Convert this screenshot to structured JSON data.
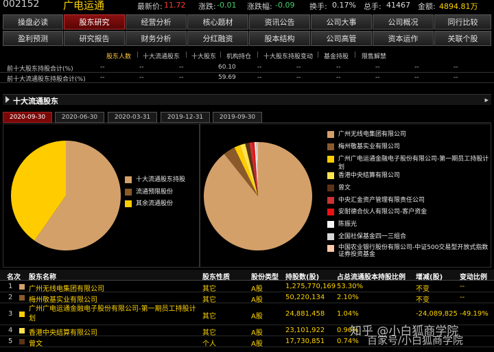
{
  "ticker": {
    "code": "002152",
    "name": "广电运通",
    "price_label": "最新价:",
    "price": "11.72",
    "change_label": "涨跌:",
    "change": "-0.01",
    "pct_label": "涨跌幅:",
    "pct": "-0.09",
    "turnover_label": "换手:",
    "turnover": "0.17%",
    "volume_label": "总手:",
    "volume": "41467",
    "amount_label": "金额:",
    "amount": "4894.81万"
  },
  "nav_row1": [
    "操盘必读",
    "股东研究",
    "经营分析",
    "核心题材",
    "资讯公告",
    "公司大事",
    "公司概况",
    "同行比较"
  ],
  "nav_row2": [
    "盈利预测",
    "研究报告",
    "财务分析",
    "分红融资",
    "股本结构",
    "公司高管",
    "资本运作",
    "关联个股"
  ],
  "active_nav": "股东研究",
  "subnav": [
    "股东人数",
    "十大流通股东",
    "十大股东",
    "机构持仓",
    "十大股东持股变动",
    "基金持股",
    "限售解禁"
  ],
  "summary_rows": [
    {
      "label": "前十大股东持股合计(%)",
      "cells": [
        "--",
        "--",
        "--",
        "60.10",
        "--",
        "--",
        "--",
        "--",
        "--",
        "--"
      ]
    },
    {
      "label": "前十大流通股东持股合计(%)",
      "cells": [
        "--",
        "--",
        "--",
        "59.69",
        "--",
        "--",
        "--",
        "--",
        "--",
        "--"
      ]
    }
  ],
  "section_title": "十大流通股东",
  "section_arrow": "▸",
  "date_tabs": [
    "2020-09-30",
    "2020-06-30",
    "2020-03-31",
    "2019-12-31",
    "2019-09-30"
  ],
  "colors": {
    "tan": "#d4a06a",
    "brown": "#8b5a2b",
    "yellow": "#ffcc00",
    "lightyellow": "#ffe34d",
    "darkbrown": "#5c3317",
    "red": "#cc3333",
    "brightred": "#ee1111",
    "white": "#f5f5f5",
    "lightgray": "#d8d8d8",
    "peach": "#ffc9a8",
    "highlight": "#ffd400"
  },
  "chart_data": [
    {
      "type": "pie",
      "series": [
        {
          "labels": [
            "十大流通股东持股",
            "流通预限股份",
            "其余流通股份"
          ],
          "values": [
            59.69,
            0.0,
            40.31
          ]
        }
      ]
    },
    {
      "type": "pie",
      "series": [
        {
          "labels": [
            "广州无线电集团有限公司",
            "梅州敬基实业有限公司",
            "广州广电运通金融电子股份有限公司-第一期员工持股计划",
            "香港中央结算有限公司",
            "曾文",
            "中央汇金资产管理有限责任公司",
            "安耐德合伙人有限公司-客户资金",
            "陈振光",
            "全国社保基金四一三组合",
            "中国农业银行股份有限公司-中证500交易型开放式指数证券投资基金"
          ],
          "values": [
            89.3,
            3.53,
            1.75,
            1.62,
            1.22,
            0.95,
            0.6,
            0.45,
            0.3,
            0.28
          ]
        }
      ]
    }
  ],
  "legend_left": [
    "十大流通股东持股",
    "流通预限股份",
    "其余流通股份"
  ],
  "legend_right": [
    "广州无线电集团有限公司",
    "梅州敬基实业有限公司",
    "广州广电运通金融电子股份有限公司-第一期员工持股计划",
    "香港中央结算有限公司",
    "曾文",
    "中央汇金资产管理有限责任公司",
    "安耐德合伙人有限公司-客户资金",
    "陈振光",
    "全国社保基金四一三组合",
    "中国农业银行股份有限公司-中证500交易型开放式指数证券投资基金"
  ],
  "table": {
    "headers": [
      "名次",
      "股东名称",
      "股东性质",
      "股份类型",
      "持股数(股)",
      "占总流通股本持股比例",
      "增减(股)",
      "变动比例"
    ],
    "rows": [
      {
        "rank": "1",
        "name": "广州无线电集团有限公司",
        "nature": "其它",
        "type": "A股",
        "shares": "1,275,770,169",
        "ratio": "53.30%",
        "change": "不变",
        "pct": "--"
      },
      {
        "rank": "2",
        "name": "梅州敬基实业有限公司",
        "nature": "其它",
        "type": "A股",
        "shares": "50,220,134",
        "ratio": "2.10%",
        "change": "不变",
        "pct": "--"
      },
      {
        "rank": "3",
        "name": "广州广电运通金融电子股份有限公司-第一期员工持股计划",
        "nature": "其它",
        "type": "A股",
        "shares": "24,881,458",
        "ratio": "1.04%",
        "change": "-24,089,825",
        "pct": "-49.19%"
      },
      {
        "rank": "4",
        "name": "香港中央结算有限公司",
        "nature": "其它",
        "type": "A股",
        "shares": "23,101,922",
        "ratio": "0.96%",
        "change": "",
        "pct": ""
      },
      {
        "rank": "5",
        "name": "曾文",
        "nature": "个人",
        "type": "A股",
        "shares": "17,730,851",
        "ratio": "0.74%",
        "change": "",
        "pct": ""
      }
    ]
  },
  "watermark": {
    "line1": "知乎 @小白狐商学院",
    "line2": "百家号/小白狐商学院"
  }
}
